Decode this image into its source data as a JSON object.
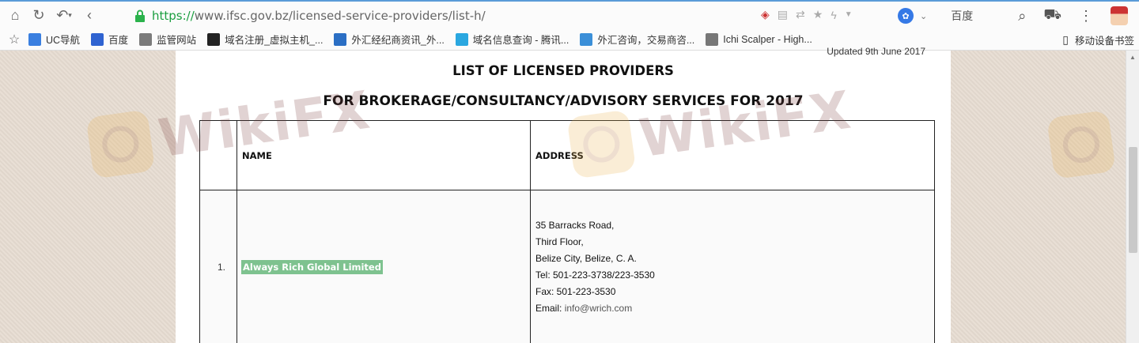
{
  "browser": {
    "url_protocol": "https://",
    "url_rest": "www.ifsc.gov.bz/licensed-service-providers/list-h/",
    "search_engine": "百度",
    "search_badge": "✿"
  },
  "bookmarks": [
    {
      "label": "UC导航",
      "icon": "uc-icon",
      "color": "#3a7fe0"
    },
    {
      "label": "百度",
      "icon": "baidu-paw-icon",
      "color": "#2f63d1"
    },
    {
      "label": "监管网站",
      "icon": "folder-icon",
      "color": "#7b7b7b"
    },
    {
      "label": "域名注册_虚拟主机_...",
      "icon": "domain-icon",
      "color": "#222222"
    },
    {
      "label": "外汇经纪商资讯_外...",
      "icon": "fx-news-icon",
      "color": "#2b6fc4"
    },
    {
      "label": "域名信息查询 - 腾讯...",
      "icon": "cloud-icon",
      "color": "#2aa7e0"
    },
    {
      "label": "外汇咨询，交易商咨...",
      "icon": "fx-consult-icon",
      "color": "#3b8fd8"
    },
    {
      "label": "Ichi Scalper - High...",
      "icon": "page-icon",
      "color": "#777777"
    }
  ],
  "mobile_bookmarks": "移动设备书签",
  "document": {
    "updated": "Updated 9th June 2017",
    "title_line1": "LIST OF LICENSED PROVIDERS",
    "title_line2": "FOR BROKERAGE/CONSULTANCY/ADVISORY SERVICES FOR  2017",
    "table": {
      "headers": [
        "",
        "NAME",
        "ADDRESS"
      ],
      "rows": [
        {
          "num": "1.",
          "name": "Always Rich Global Limited",
          "address": [
            "35 Barracks Road,",
            "Third Floor,",
            "Belize City, Belize, C. A.",
            "Tel: 501-223-3738/223-3530",
            "Fax: 501-223-3530"
          ],
          "email_label": "Email: ",
          "email": "info@wrich.com"
        }
      ]
    }
  },
  "watermark": {
    "text": "WikiFX",
    "logo_color": "#e9b24a",
    "text_color": "#7a3c3c"
  },
  "colors": {
    "highlight": "#7ec28f",
    "url_green": "#1a9e3f",
    "page_bg": "#e7ddd2"
  }
}
